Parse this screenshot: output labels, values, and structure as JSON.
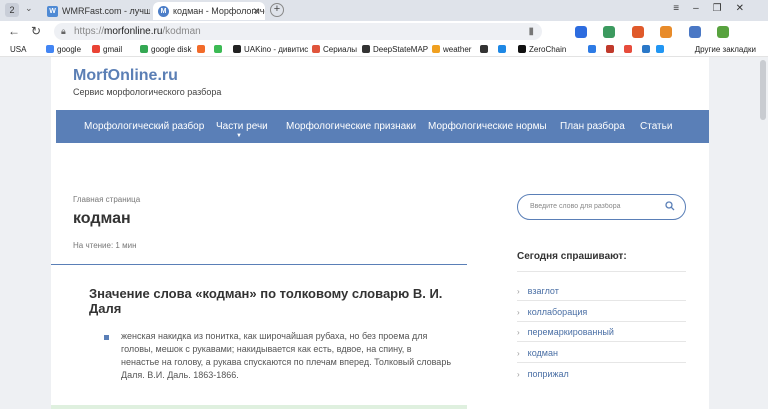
{
  "browser": {
    "tab_count": "2",
    "tabs": [
      {
        "title": "WMRFast.com - лучшее м",
        "favicon": "W"
      },
      {
        "title": "кодман - Морфологическ",
        "favicon": "M"
      }
    ],
    "url": {
      "protocol": "https://",
      "host": "morfonline.ru",
      "path": "/kodman"
    },
    "bookmarks": [
      {
        "label": "USA",
        "color": "#ffffff"
      },
      {
        "label": "google",
        "color": "#4285f4"
      },
      {
        "label": "gmail",
        "color": "#ea4335"
      },
      {
        "label": "google disk",
        "color": "#34a853"
      },
      {
        "label": "",
        "color": "#f26b2a"
      },
      {
        "label": "",
        "color": "#3cba54"
      },
      {
        "label": "UAKino - дивитис",
        "color": "#222222"
      },
      {
        "label": "Сериалы",
        "color": "#e0553c"
      },
      {
        "label": "DeepStateMAP",
        "color": "#333333"
      },
      {
        "label": "weather",
        "color": "#f0a020"
      },
      {
        "label": "",
        "color": "#333333"
      },
      {
        "label": "",
        "color": "#1e88e5"
      },
      {
        "label": "ZeroChain",
        "color": "#111111"
      },
      {
        "label": "",
        "color": "#2d7be5"
      },
      {
        "label": "",
        "color": "#c0392b"
      },
      {
        "label": "",
        "color": "#e74c3c"
      },
      {
        "label": "",
        "color": "#2a78c8"
      },
      {
        "label": "",
        "color": "#2196f3"
      }
    ],
    "bookmarks_other": "Другие закладки"
  },
  "site": {
    "logo": "MorfOnline.ru",
    "tagline": "Сервис морфологического разбора",
    "menu": [
      {
        "label": "Морфологический разбор"
      },
      {
        "label": "Части речи"
      },
      {
        "label": "Морфологические признаки"
      },
      {
        "label": "Морфологические нормы"
      },
      {
        "label": "План разбора"
      },
      {
        "label": "Статьи"
      }
    ],
    "breadcrumb": "Главная страница",
    "word": "кодман",
    "read_time": "На чтение: 1 мин",
    "article_title": "Значение слова «кодман» по толковому словарю В. И. Даля",
    "definition": "женская накидка из понитка, как широчайшая рубаха, но без проема для головы, мешок с рукавами; накидывается как есть, вдвое, на спину, в ненастье на голову, а рукава спускаются по плечам вперед. Толковый словарь Даля. В.И. Даль. 1863-1866.",
    "search_placeholder": "Введите слово для разбора",
    "sidebar_title": "Сегодня спрашивают:",
    "sidebar_items": [
      "взаглот",
      "коллаборация",
      "перемаркированный",
      "кодман",
      "поприжал"
    ],
    "accent_color": "#5a7fb7"
  }
}
